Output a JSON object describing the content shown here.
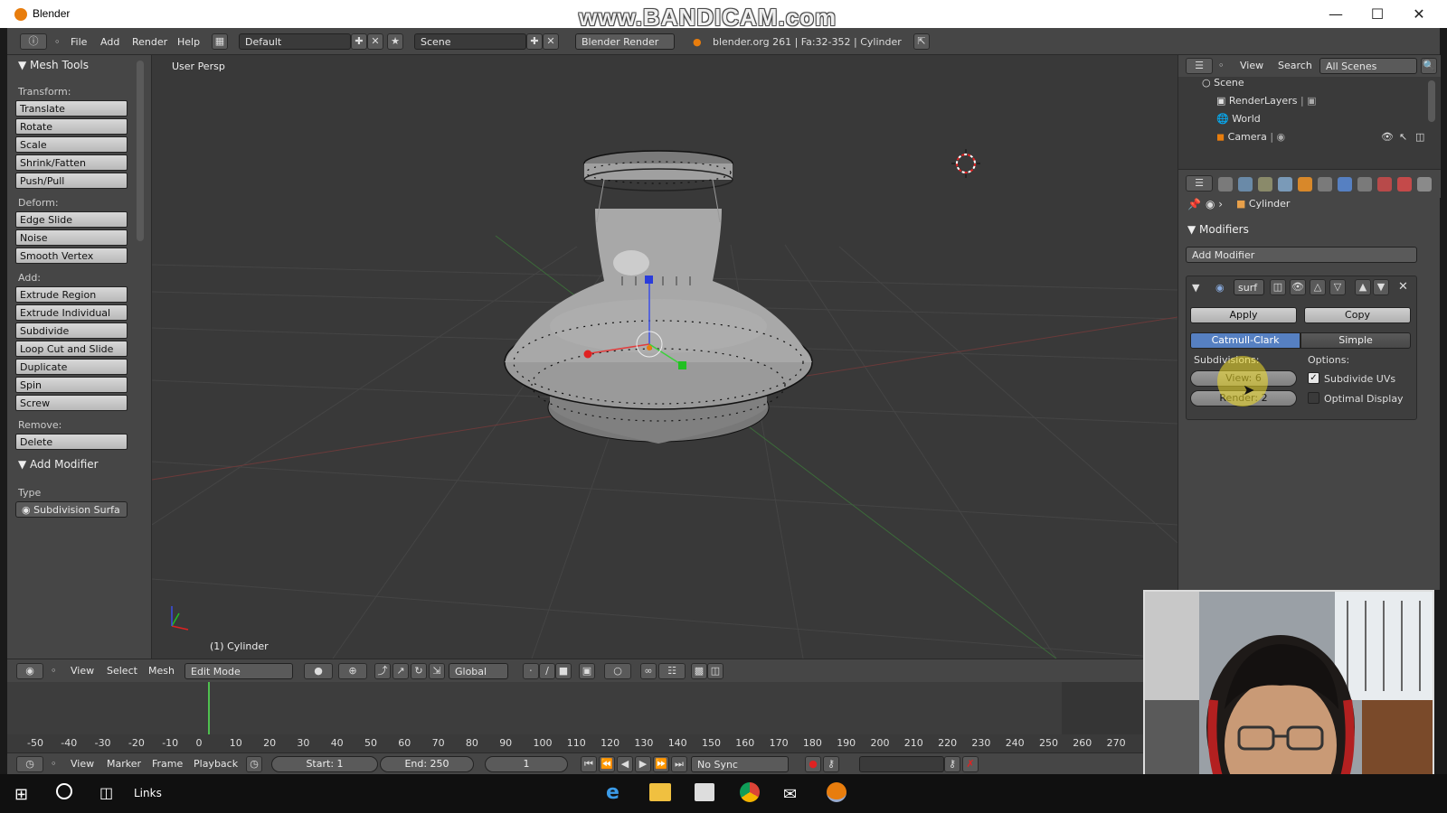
{
  "window": {
    "title": "Blender",
    "watermark": "www.BANDICAM.com"
  },
  "menu": {
    "file": "File",
    "add": "Add",
    "render": "Render",
    "help": "Help"
  },
  "screen_layout": "Default",
  "scene_name": "Scene",
  "render_engine": "Blender Render",
  "stats": "blender.org 261 | Fa:32-352 | Cylinder",
  "tool_shelf": {
    "panel_title": "Mesh Tools",
    "transform_label": "Transform:",
    "transform": [
      "Translate",
      "Rotate",
      "Scale",
      "Shrink/Fatten",
      "Push/Pull"
    ],
    "deform_label": "Deform:",
    "deform": [
      "Edge Slide",
      "Noise",
      "Smooth Vertex"
    ],
    "add_label": "Add:",
    "add": [
      "Extrude Region",
      "Extrude Individual",
      "Subdivide",
      "Loop Cut and Slide",
      "Duplicate",
      "Spin",
      "Screw"
    ],
    "remove_label": "Remove:",
    "remove": [
      "Delete"
    ],
    "add_modifier_title": "Add Modifier",
    "type_label": "Type",
    "type_value": "Subdivision Surfa"
  },
  "viewport": {
    "view_label": "User Persp",
    "object_label": "(1) Cylinder"
  },
  "header3d": {
    "view": "View",
    "select": "Select",
    "mesh": "Mesh",
    "mode": "Edit Mode",
    "orientation": "Global"
  },
  "timeline": {
    "ticks": [
      "-50",
      "-40",
      "-30",
      "-20",
      "-10",
      "0",
      "10",
      "20",
      "30",
      "40",
      "50",
      "60",
      "70",
      "80",
      "90",
      "100",
      "110",
      "120",
      "130",
      "140",
      "150",
      "160",
      "170",
      "180",
      "190",
      "200",
      "210",
      "220",
      "230",
      "240",
      "250",
      "260",
      "270"
    ],
    "view": "View",
    "marker": "Marker",
    "frame": "Frame",
    "playback": "Playback",
    "start": "Start: 1",
    "end": "End: 250",
    "current": "1",
    "sync": "No Sync"
  },
  "outliner": {
    "view": "View",
    "search": "Search",
    "scenes": "All Scenes",
    "items": [
      "Scene",
      "RenderLayers",
      "World",
      "Camera"
    ]
  },
  "properties": {
    "breadcrumb": "Cylinder",
    "modifiers_title": "Modifiers",
    "add_modifier": "Add Modifier",
    "mod_name": "surf",
    "apply": "Apply",
    "copy": "Copy",
    "catmull": "Catmull-Clark",
    "simple": "Simple",
    "subdivisions_label": "Subdivisions:",
    "view_field": "View: 6",
    "render_field": "Render: 2",
    "options_label": "Options:",
    "subdivide_uvs": "Subdivide UVs",
    "optimal_display": "Optimal Display"
  },
  "taskbar": {
    "links": "Links"
  }
}
